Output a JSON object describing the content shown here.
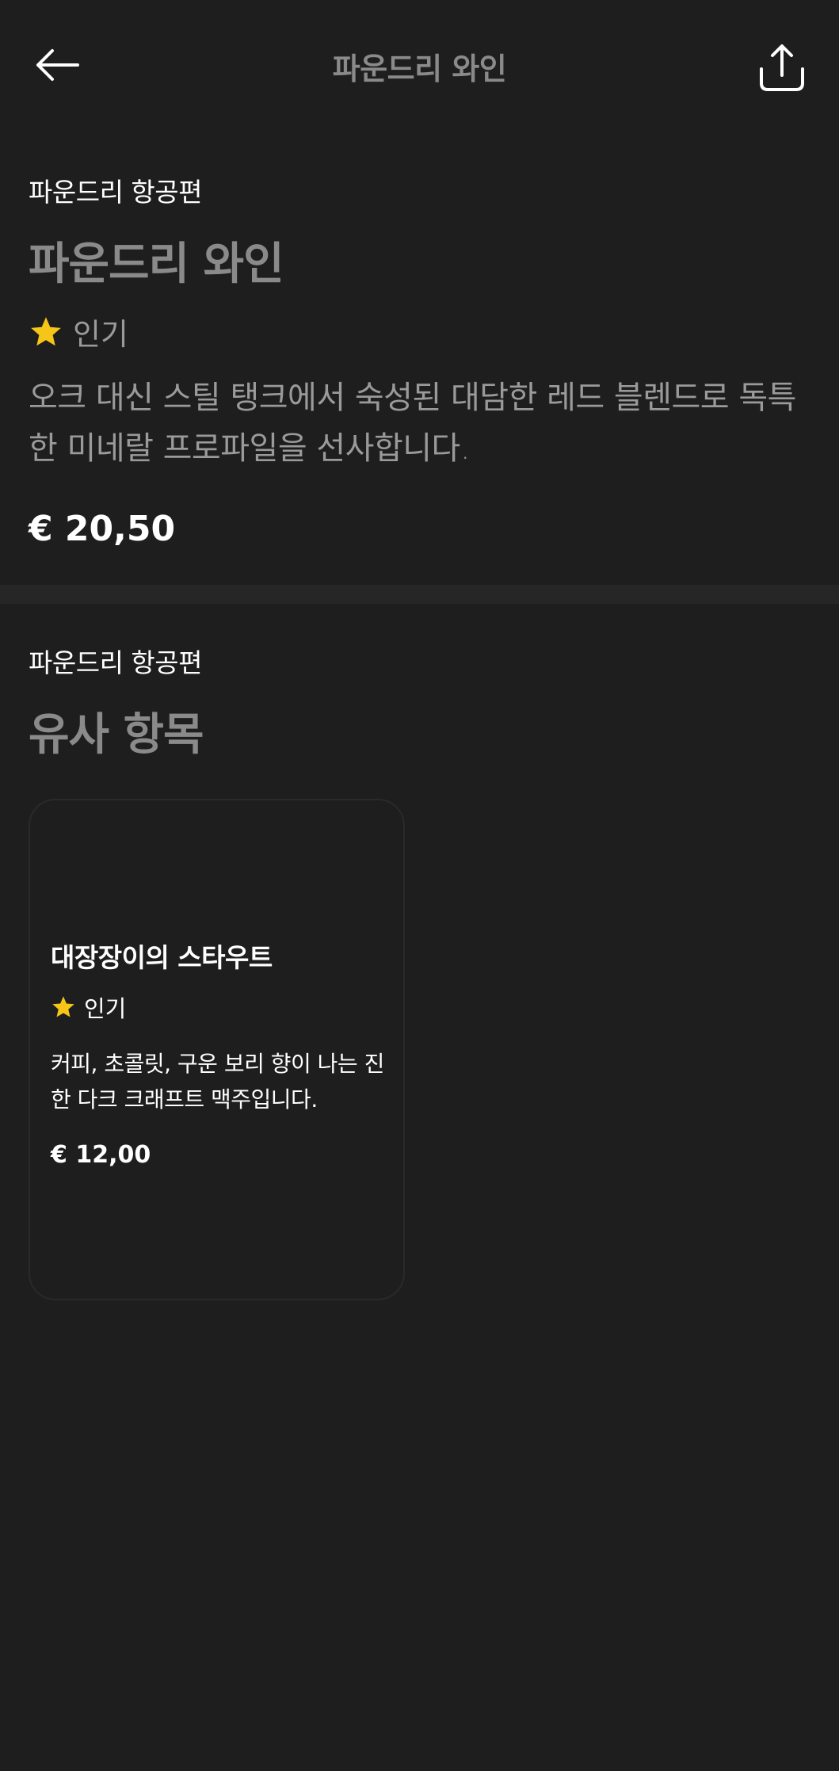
{
  "header": {
    "title": "파운드리 와인"
  },
  "product": {
    "category": "파운드리 항공편",
    "title": "파운드리 와인",
    "badge": "인기",
    "description": "오크 대신 스틸 탱크에서 숙성된 대담한 레드 블렌드로 독특한 미네랄 프로파일을 선사합니다.",
    "price": "€ 20,50"
  },
  "similar": {
    "category": "파운드리 항공편",
    "title": "유사 항목",
    "items": [
      {
        "title": "대장장이의 스타우트",
        "badge": "인기",
        "description": "커피, 초콜릿, 구운 보리 향이 나는 진한 다크 크래프트 맥주입니다.",
        "price": "€ 12,00"
      }
    ]
  },
  "icons": {
    "back": "arrow-left-icon",
    "share": "share-icon",
    "badge": "star-icon"
  },
  "colors": {
    "background": "#1e1e1e",
    "star": "#f5c518",
    "muted_text": "#8a8a8a"
  }
}
